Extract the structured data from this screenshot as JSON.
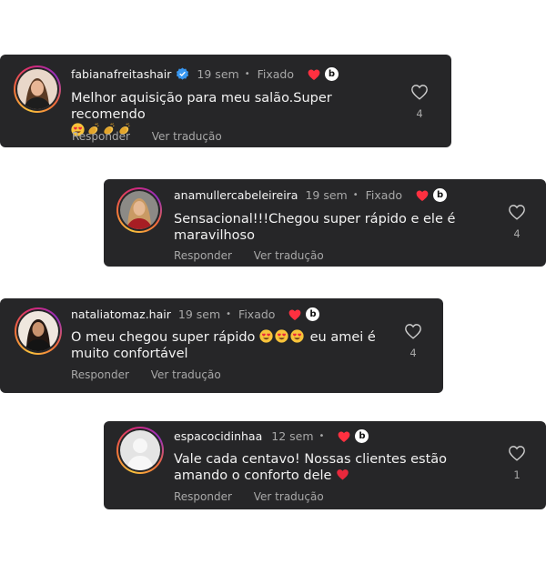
{
  "comments": [
    {
      "username": "fabianafreitashair",
      "time": "19 sem",
      "pinned": "Fixado",
      "text": "Melhor aquisição para meu salão.Super recomendo",
      "reply": "Responder",
      "translate": "Ver tradução",
      "likes": "4"
    },
    {
      "username": "anamullercabeleireira",
      "time": "19 sem",
      "pinned": "Fixado",
      "text": "Sensacional!!!Chegou super rápido e ele é maravilhoso",
      "reply": "Responder",
      "translate": "Ver tradução",
      "likes": "4"
    },
    {
      "username": "nataliatomaz.hair",
      "time": "19 sem",
      "pinned": "Fixado",
      "text_before": "O meu chegou super rápido",
      "text_after": "eu amei é muito confortável",
      "reply": "Responder",
      "translate": "Ver tradução",
      "likes": "4"
    },
    {
      "username": "espacocidinhaa",
      "time": "12 sem",
      "text": "Vale cada centavo! Nossas clientes estão amando o conforto dele",
      "reply": "Responder",
      "translate": "Ver tradução",
      "likes": "1"
    }
  ],
  "badge_letter": "b",
  "dot": "•",
  "colors": {
    "card_bg": "#262628",
    "heart_red": "#ff3040",
    "verified_blue": "#3897f0",
    "muted_text": "#a8a8a8"
  },
  "icons": [
    "heart-outline-icon",
    "heart-filled-icon",
    "verified-badge-icon",
    "heart-eyes-emoji",
    "clapping-hands-emoji",
    "red-heart-emoji"
  ]
}
